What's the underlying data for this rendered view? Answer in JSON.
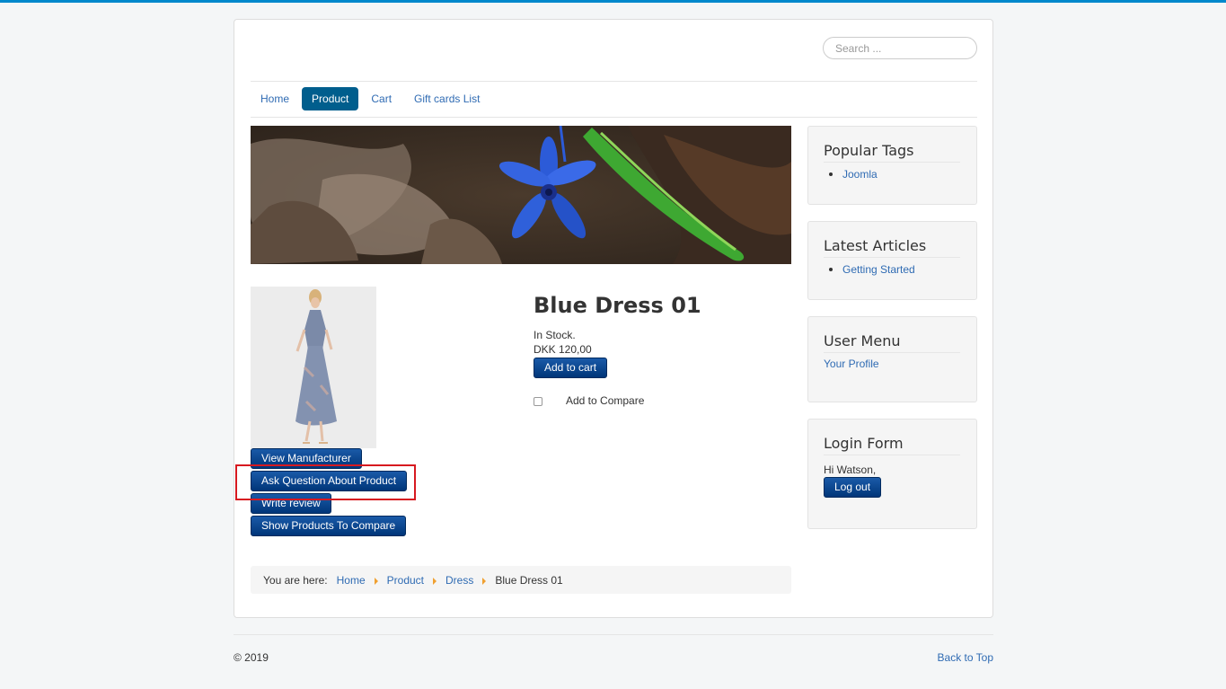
{
  "search": {
    "placeholder": "Search ..."
  },
  "nav": [
    {
      "label": "Home",
      "active": false
    },
    {
      "label": "Product",
      "active": true
    },
    {
      "label": "Cart",
      "active": false
    },
    {
      "label": "Gift cards List",
      "active": false
    }
  ],
  "product": {
    "title": "Blue Dress 01",
    "stock": "In Stock.",
    "price": "DKK 120,00",
    "add_to_cart": "Add to cart",
    "add_to_compare": "Add to Compare",
    "buttons": {
      "view_manufacturer": "View Manufacturer",
      "ask_question": "Ask Question About Product",
      "write_review": "Write review",
      "show_compare": "Show Products To Compare"
    }
  },
  "breadcrumb": {
    "prefix": "You are here:",
    "items": [
      "Home",
      "Product",
      "Dress"
    ],
    "current": "Blue Dress 01"
  },
  "sidebar": {
    "popular_tags": {
      "title": "Popular Tags",
      "items": [
        "Joomla"
      ]
    },
    "latest_articles": {
      "title": "Latest Articles",
      "items": [
        "Getting Started"
      ]
    },
    "user_menu": {
      "title": "User Menu",
      "link": "Your Profile"
    },
    "login_form": {
      "title": "Login Form",
      "greeting": "Hi Watson,",
      "logout": "Log out"
    }
  },
  "footer": {
    "copyright": "© 2019",
    "back_to_top": "Back to Top"
  },
  "colors": {
    "accent": "#0088cc",
    "nav_active": "#005e8d",
    "button": "#003679",
    "link": "#2f6bb3",
    "highlight_box": "#d71920"
  }
}
